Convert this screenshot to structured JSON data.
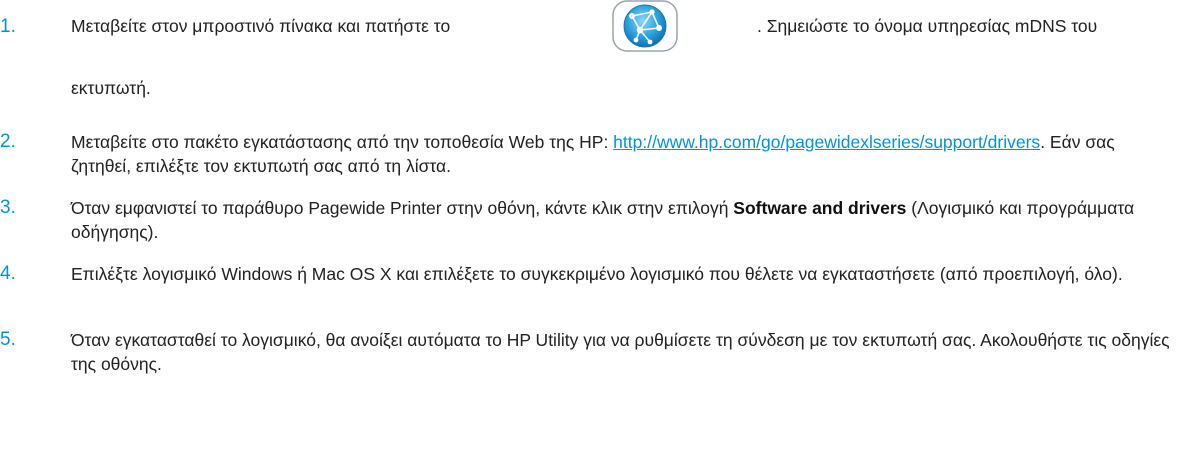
{
  "steps": [
    {
      "number": "1.",
      "text_before_icon": "Μεταβείτε στον μπροστινό πίνακα και πατήστε το",
      "icon": "network-globe-icon",
      "text_after_icon": ". Σημειώστε το όνομα υπηρεσίας mDNS του",
      "text_line2": "εκτυπωτή."
    },
    {
      "number": "2.",
      "text_before_link": "Μεταβείτε στο πακέτο εγκατάστασης από την τοποθεσία Web της HP: ",
      "link": "http://www.hp.com/go/pagewidexlseries/support/drivers",
      "text_after_link": ". Εάν σας ζητηθεί, επιλέξτε τον εκτυπωτή σας από τη λίστα."
    },
    {
      "number": "3.",
      "text_before_bold": "Όταν εμφανιστεί το παράθυρο Pagewide Printer στην οθόνη, κάντε κλικ στην επιλογή ",
      "bold": "Software and drivers",
      "text_after_bold": " (Λογισμικό και προγράμματα οδήγησης)."
    },
    {
      "number": "4.",
      "text": "Επιλέξτε λογισμικό Windows ή Mac OS X και επιλέξετε το συγκεκριμένο λογισμικό που θέλετε να εγκαταστήσετε (από προεπιλογή, όλο)."
    },
    {
      "number": "5.",
      "text": "Όταν εγκατασταθεί το λογισμικό, θα ανοίξει αυτόματα το HP Utility για να ρυθμίσετε τη σύνδεση με τον εκτυπωτή σας. Ακολουθήστε τις οδηγίες της οθόνης."
    }
  ],
  "colors": {
    "accent": "#0096d6",
    "text": "#222222"
  }
}
